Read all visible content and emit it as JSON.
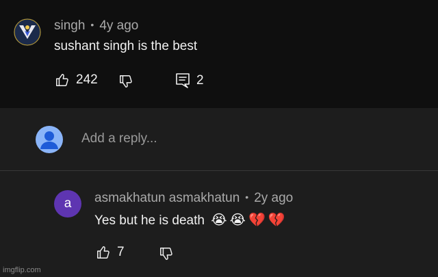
{
  "comment": {
    "author": "singh",
    "separator": "•",
    "time": "4y ago",
    "text": "sushant singh is the best",
    "likes": "242",
    "replies": "2"
  },
  "reply_box": {
    "placeholder": "Add a reply..."
  },
  "reply": {
    "avatar_letter": "a",
    "author": "asmakhatun asmakhatun",
    "separator": "•",
    "time": "2y ago",
    "text": "Yes but he is death",
    "emojis": [
      "😭",
      "😭",
      "💔",
      "💔"
    ],
    "likes": "7"
  },
  "colors": {
    "background": "#0f0f0f",
    "panel": "#1d1d1d",
    "reply_avatar": "#5e35b1",
    "default_avatar": "#8ab4f8"
  },
  "icons": [
    "thumbs-up-icon",
    "thumbs-down-icon",
    "comment-icon",
    "person-icon"
  ],
  "watermark": "imgflip.com"
}
